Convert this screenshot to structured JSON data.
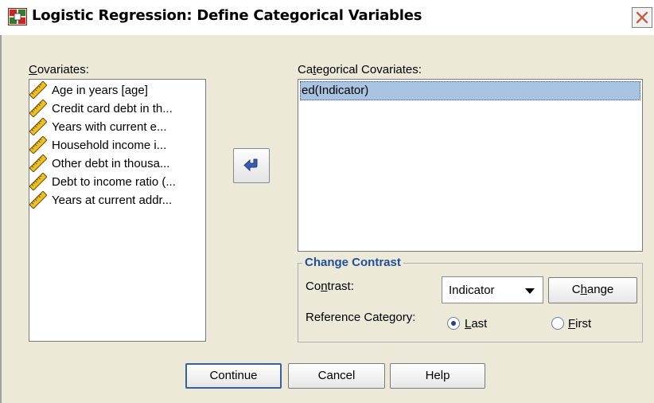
{
  "window": {
    "title": "Logistic Regression: Define Categorical Variables"
  },
  "covariates": {
    "label_prefix": "",
    "label_hotkey": "C",
    "label_rest": "ovariates:",
    "items": [
      {
        "label": "Age in years [age]",
        "icon": "scale-ruler-icon"
      },
      {
        "label": "Credit card debt in th...",
        "icon": "scale-ruler-icon"
      },
      {
        "label": "Years with current e...",
        "icon": "scale-ruler-icon"
      },
      {
        "label": "Household income i...",
        "icon": "scale-ruler-icon"
      },
      {
        "label": "Other debt in thousa...",
        "icon": "scale-ruler-icon"
      },
      {
        "label": "Debt to income ratio (...",
        "icon": "scale-ruler-icon"
      },
      {
        "label": "Years at current addr...",
        "icon": "scale-ruler-icon"
      }
    ]
  },
  "move_button": {
    "icon": "arrow-left-icon"
  },
  "categorical": {
    "label_prefix": "Ca",
    "label_hotkey": "t",
    "label_rest": "egorical Covariates:",
    "items": [
      {
        "label": "ed(Indicator)",
        "selected": true
      }
    ]
  },
  "change_contrast": {
    "title": "Change Contrast",
    "contrast_label_prefix": "Co",
    "contrast_label_hotkey": "n",
    "contrast_label_rest": "trast:",
    "contrast_value": "Indicator",
    "change_prefix": "C",
    "change_hotkey": "h",
    "change_rest": "ange",
    "reference_label": "Reference Category:",
    "last_hotkey": "L",
    "last_rest": "ast",
    "first_hotkey": "F",
    "first_rest": "irst",
    "selected_reference": "Last"
  },
  "buttons": {
    "continue": "Continue",
    "cancel": "Cancel",
    "help": "Help"
  },
  "colors": {
    "dialog_bg": "#ece9d8",
    "selection_bg": "#a8c4e0",
    "group_title": "#1f4e9a"
  }
}
